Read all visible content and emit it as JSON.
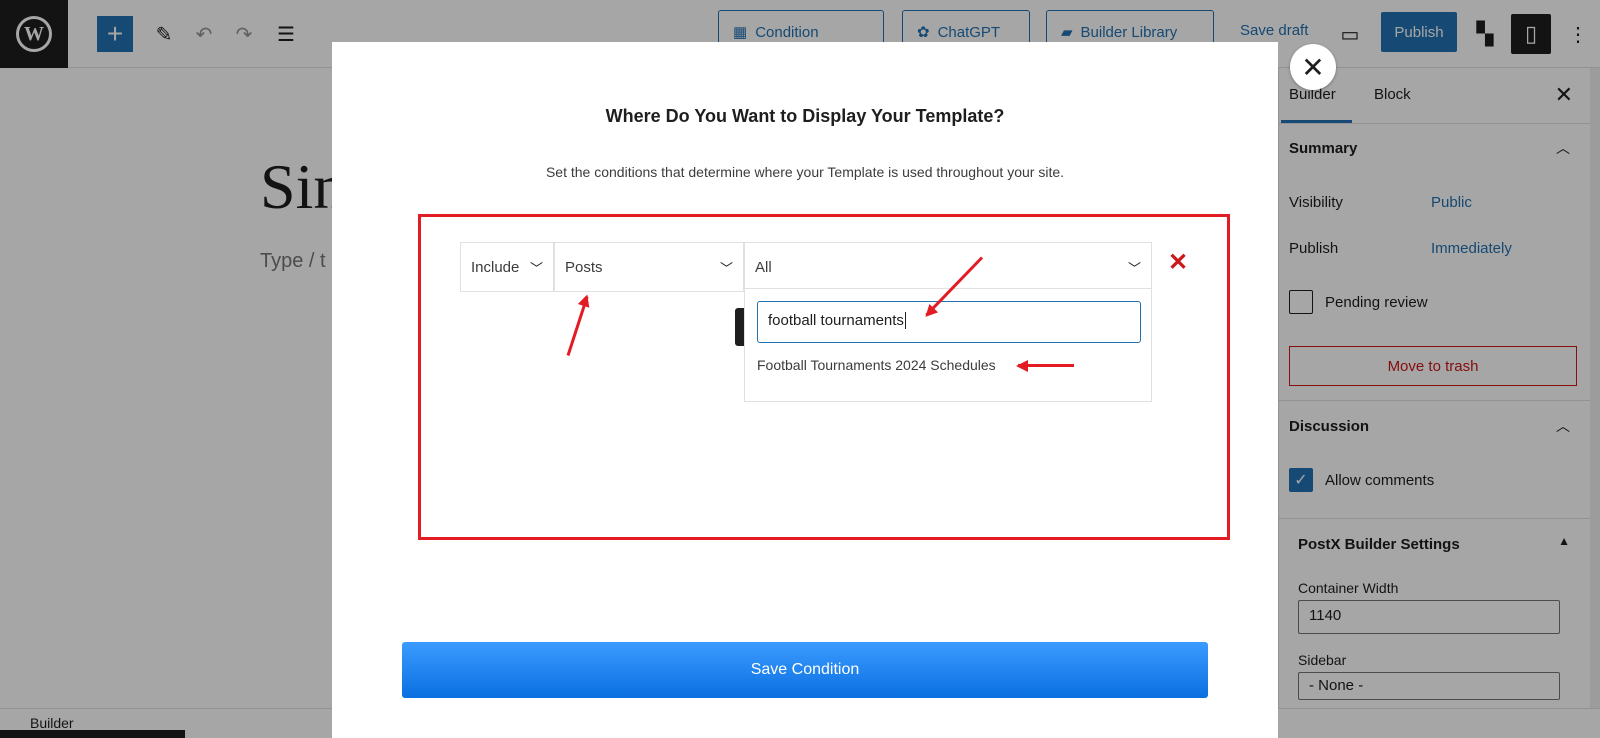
{
  "topbar": {
    "condition_label": "Condition",
    "chatgpt_label": "ChatGPT",
    "builder_library_label": "Builder Library",
    "save_draft_label": "Save draft",
    "publish_label": "Publish"
  },
  "canvas": {
    "title_partial": "Sin",
    "hint_partial": "Type / t"
  },
  "statusbar": {
    "label": "Builder"
  },
  "sidebar": {
    "tabs": [
      {
        "label": "Builder"
      },
      {
        "label": "Block"
      }
    ],
    "summary_title": "Summary",
    "visibility_label": "Visibility",
    "visibility_value": "Public",
    "publish_label": "Publish",
    "publish_value": "Immediately",
    "pending_review_label": "Pending review",
    "move_to_trash_label": "Move to trash",
    "discussion_title": "Discussion",
    "allow_comments_label": "Allow comments",
    "postx_title": "PostX Builder Settings",
    "container_width_label": "Container Width",
    "container_width_value": "1140",
    "sidebar_label": "Sidebar",
    "sidebar_value": "- None -"
  },
  "modal": {
    "title": "Where Do You Want to Display Your Template?",
    "subtitle": "Set the conditions that determine where your Template is used throughout your site.",
    "include_select": "Include",
    "type_select": "Posts",
    "scope_select": "All",
    "search_value": "football tournaments",
    "result_option": "Football Tournaments 2024 Schedules",
    "save_button": "Save Condition"
  },
  "colors": {
    "accent": "#2271b1",
    "annotation_red": "#e31b23",
    "save_gradient_top": "#3b9bff",
    "save_gradient_bottom": "#0a6fe0"
  }
}
